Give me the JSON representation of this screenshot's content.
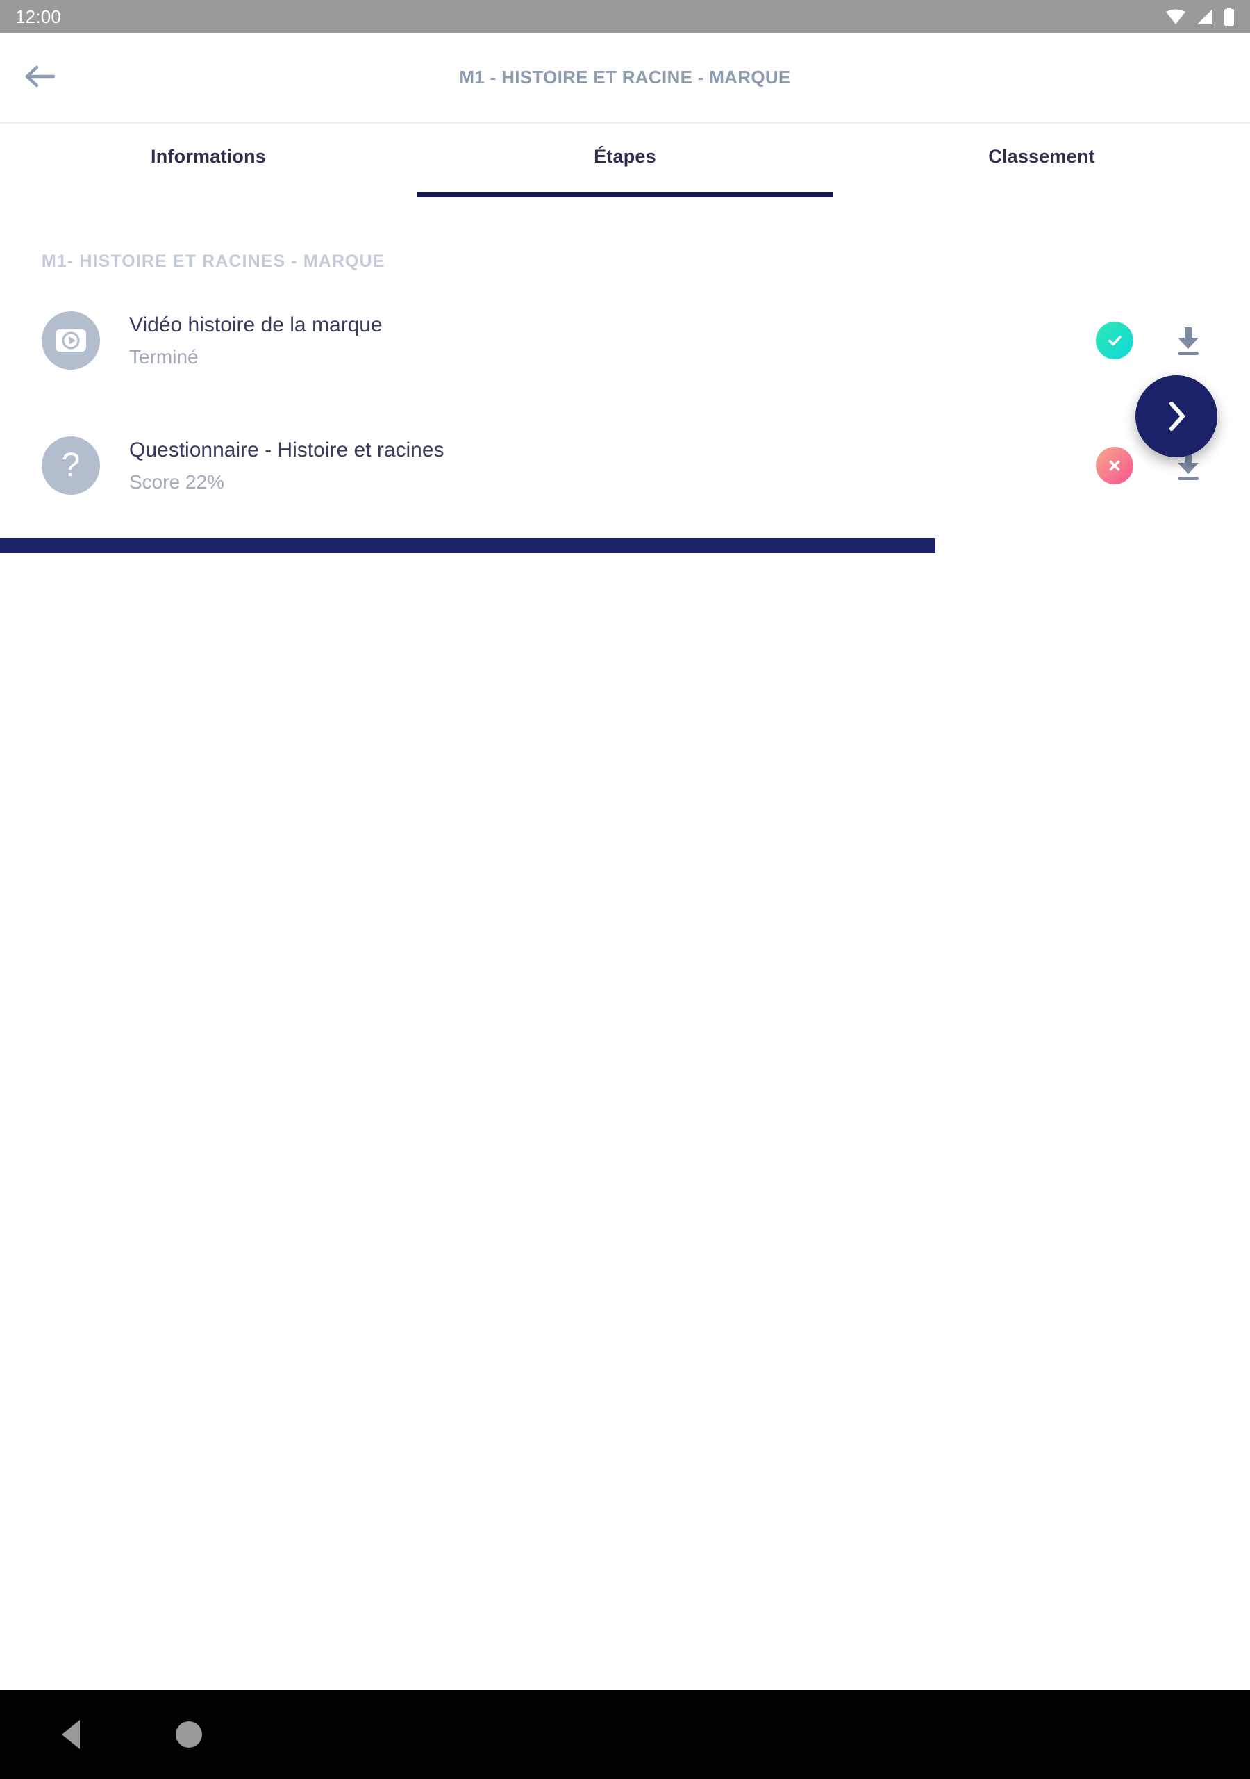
{
  "status_bar": {
    "clock": "12:00",
    "icons": [
      "wifi-icon",
      "cell-signal-icon",
      "battery-icon"
    ]
  },
  "app_bar": {
    "back_icon": "arrow-left-icon",
    "title": "M1 - HISTOIRE ET RACINE - MARQUE",
    "title_color": "#8d9bb1"
  },
  "tabs": {
    "active_index": 1,
    "active_color": "#15195c",
    "label_color": "#302c4e",
    "items": [
      {
        "label": "Informations"
      },
      {
        "label": "Étapes"
      },
      {
        "label": "Classement"
      }
    ]
  },
  "main": {
    "section_title": "M1- HISTOIRE ET RACINES - MARQUE",
    "section_title_color": "#c3cad8",
    "steps": [
      {
        "icon": "video-play-icon",
        "title": "Vidéo histoire de la marque",
        "subtitle": "Terminé",
        "status": "completed",
        "status_icon": "check-circle-icon",
        "status_color": "#12d8c4",
        "download_icon": "download-icon"
      },
      {
        "icon": "question-mark-icon",
        "title": "Questionnaire - Histoire et racines",
        "subtitle": "Score 22%",
        "status": "failed",
        "status_icon": "close-circle-icon",
        "status_color": "#f7538f",
        "download_icon": "download-icon"
      }
    ]
  },
  "fab": {
    "icon": "chevron-right-icon",
    "color": "#1b2268"
  },
  "system_nav": {
    "accent_color": "#1b2268",
    "buttons": [
      {
        "icon": "nav-back-triangle-icon"
      },
      {
        "icon": "nav-home-circle-icon"
      }
    ]
  }
}
